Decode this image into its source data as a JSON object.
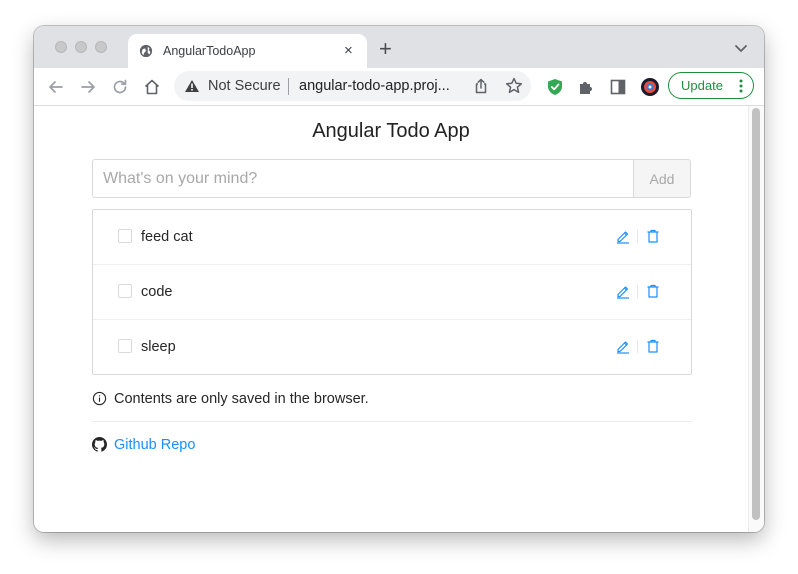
{
  "browser": {
    "tab_title": "AngularTodoApp",
    "tab_close": "×",
    "new_tab": "+",
    "security_label": "Not Secure",
    "url": "angular-todo-app.proj...",
    "update_label": "Update"
  },
  "app": {
    "title": "Angular Todo App",
    "input_placeholder": "What's on your mind?",
    "input_value": "",
    "add_label": "Add",
    "todos": [
      {
        "text": "feed cat",
        "done": false
      },
      {
        "text": "code",
        "done": false
      },
      {
        "text": "sleep",
        "done": false
      }
    ],
    "notice": "Contents are only saved in the browser.",
    "repo_link": "Github Repo"
  },
  "colors": {
    "link": "#1890ff",
    "update_green": "#1e8e3e",
    "tabbar": "#dfe1e5"
  },
  "icons": [
    "globe-icon",
    "close-icon",
    "plus-icon",
    "chevron-down-icon",
    "back-arrow-icon",
    "forward-arrow-icon",
    "reload-icon",
    "home-icon",
    "warning-icon",
    "share-icon",
    "star-icon",
    "shield-extension-icon",
    "puzzle-icon",
    "side-panel-icon",
    "profile-avatar-icon",
    "kebab-icon",
    "edit-icon",
    "trash-icon",
    "info-icon",
    "github-icon"
  ]
}
